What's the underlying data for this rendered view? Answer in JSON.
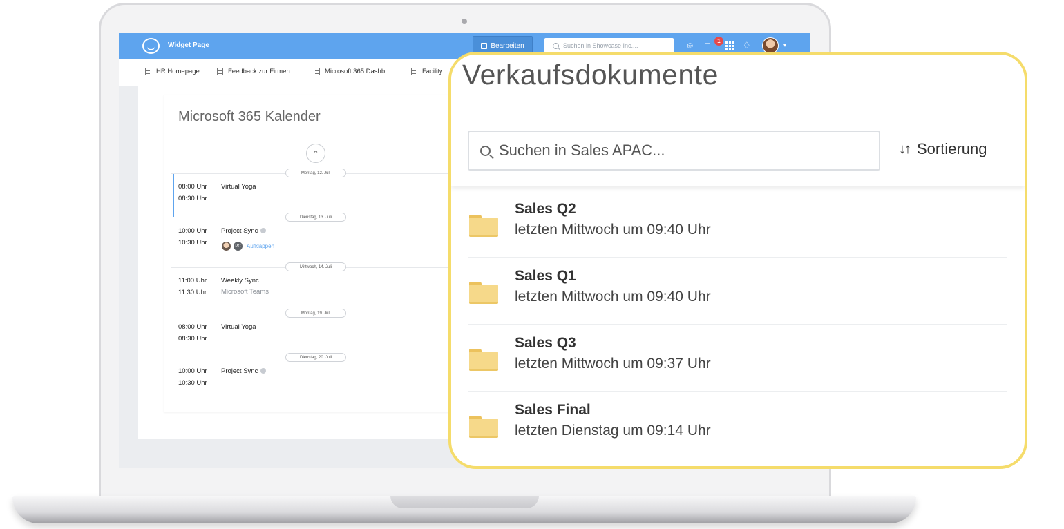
{
  "app": {
    "title": "Widget Page",
    "edit_label": "Bearbeiten",
    "search_placeholder": "Suchen in Showcase Inc....",
    "notification_count": "1",
    "caret": "▾"
  },
  "tabs": [
    {
      "label": "HR Homepage"
    },
    {
      "label": "Feedback zur Firmen..."
    },
    {
      "label": "Microsoft 365 Dashb..."
    },
    {
      "label": "Facility"
    }
  ],
  "calendar": {
    "title": "Microsoft 365 Kalender",
    "expand_label": "Aufklappen",
    "avatar_initials": "PC",
    "days": [
      {
        "date": "Montag, 12. Juli",
        "start": "08:00 Uhr",
        "end": "08:30 Uhr",
        "title": "Virtual Yoga",
        "sub": ""
      },
      {
        "date": "Dienstag, 13. Juli",
        "start": "10:00 Uhr",
        "end": "10:30 Uhr",
        "title": "Project Sync",
        "sub": ""
      },
      {
        "date": "Mittwoch, 14. Juli",
        "start": "11:00 Uhr",
        "end": "11:30 Uhr",
        "title": "Weekly Sync",
        "sub": "Microsoft Teams"
      },
      {
        "date": "Montag, 19. Juli",
        "start": "08:00 Uhr",
        "end": "08:30 Uhr",
        "title": "Virtual Yoga",
        "sub": ""
      },
      {
        "date": "Dienstag, 20. Juli",
        "start": "10:00 Uhr",
        "end": "10:30 Uhr",
        "title": "Project Sync",
        "sub": ""
      }
    ]
  },
  "documents": {
    "title": "Verkaufsdokumente",
    "search_placeholder": "Suchen in Sales APAC...",
    "sort_label": "Sortierung",
    "sort_icon": "↓↑",
    "items": [
      {
        "name": "Sales Q2",
        "modified": "letzten Mittwoch um 09:40 Uhr"
      },
      {
        "name": "Sales Q1",
        "modified": "letzten Mittwoch um 09:40 Uhr"
      },
      {
        "name": "Sales Q3",
        "modified": "letzten Mittwoch um 09:37 Uhr"
      },
      {
        "name": "Sales Final",
        "modified": "letzten Dienstag um 09:14 Uhr"
      }
    ]
  },
  "colors": {
    "topbar": "#5ea4ee",
    "highlight_border": "#f5dc6b",
    "folder": "#f6d98a",
    "badge": "#e84a4a"
  }
}
